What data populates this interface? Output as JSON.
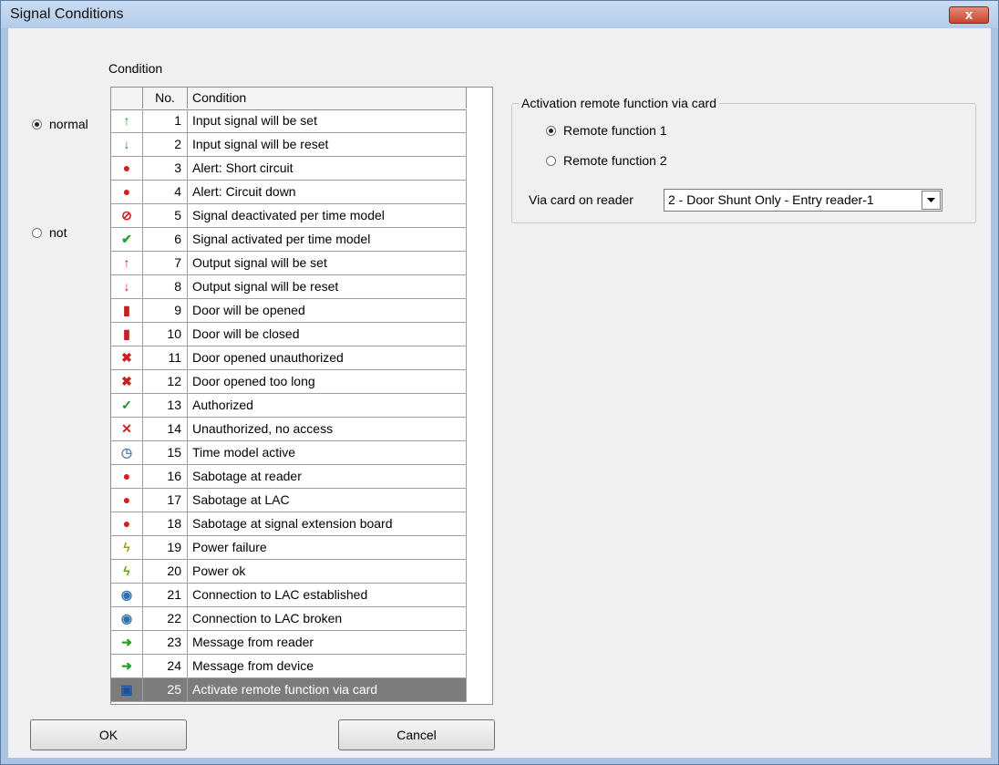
{
  "window": {
    "title": "Signal Conditions",
    "close_label": "x"
  },
  "condition_label": "Condition",
  "mode": {
    "normal": {
      "label": "normal",
      "checked": true
    },
    "not": {
      "label": "not",
      "checked": false
    }
  },
  "grid": {
    "headers": {
      "no": "No.",
      "condition": "Condition"
    },
    "rows": [
      {
        "icon": "arrow-up-green-icon",
        "glyph": "↑",
        "color": "#1aa31a",
        "no": "1",
        "label": "Input signal will be set"
      },
      {
        "icon": "arrow-down-green-icon",
        "glyph": "↓",
        "color": "#1aa31a",
        "no": "2",
        "label": "Input signal will be reset"
      },
      {
        "icon": "alarm-short-circuit-icon",
        "glyph": "●",
        "color": "#d32020",
        "no": "3",
        "label": "Alert: Short circuit"
      },
      {
        "icon": "alarm-circuit-down-icon",
        "glyph": "●",
        "color": "#d32020",
        "no": "4",
        "label": "Alert: Circuit down"
      },
      {
        "icon": "no-entry-icon",
        "glyph": "⊘",
        "color": "#d32020",
        "no": "5",
        "label": "Signal deactivated per time model"
      },
      {
        "icon": "check-circle-icon",
        "glyph": "✔",
        "color": "#2a9e2a",
        "no": "6",
        "label": "Signal activated per time model"
      },
      {
        "icon": "arrow-up-red-icon",
        "glyph": "↑",
        "color": "#d32020",
        "no": "7",
        "label": "Output signal will be set"
      },
      {
        "icon": "arrow-down-red-icon",
        "glyph": "↓",
        "color": "#d32020",
        "no": "8",
        "label": "Output signal will be reset"
      },
      {
        "icon": "door-open-icon",
        "glyph": "▮",
        "color": "#c62020",
        "no": "9",
        "label": "Door will be opened"
      },
      {
        "icon": "door-closed-icon",
        "glyph": "▮",
        "color": "#c62020",
        "no": "10",
        "label": "Door will be closed"
      },
      {
        "icon": "door-unauthorized-icon",
        "glyph": "✖",
        "color": "#c62020",
        "no": "11",
        "label": "Door opened unauthorized"
      },
      {
        "icon": "door-too-long-icon",
        "glyph": "✖",
        "color": "#c62020",
        "no": "12",
        "label": "Door opened too long"
      },
      {
        "icon": "checkmark-icon",
        "glyph": "✓",
        "color": "#1a8a1a",
        "no": "13",
        "label": "Authorized"
      },
      {
        "icon": "cross-icon",
        "glyph": "✕",
        "color": "#d32020",
        "no": "14",
        "label": "Unauthorized, no access"
      },
      {
        "icon": "clock-icon",
        "glyph": "◷",
        "color": "#5a7ea8",
        "no": "15",
        "label": "Time model active"
      },
      {
        "icon": "sabotage-reader-icon",
        "glyph": "●",
        "color": "#d32020",
        "no": "16",
        "label": "Sabotage at reader"
      },
      {
        "icon": "sabotage-lac-icon",
        "glyph": "●",
        "color": "#d32020",
        "no": "17",
        "label": "Sabotage at LAC"
      },
      {
        "icon": "sabotage-extension-icon",
        "glyph": "●",
        "color": "#d32020",
        "no": "18",
        "label": "Sabotage at signal extension board"
      },
      {
        "icon": "power-failure-icon",
        "glyph": "ϟ",
        "color": "#9a9a1a",
        "no": "19",
        "label": "Power failure"
      },
      {
        "icon": "power-ok-icon",
        "glyph": "ϟ",
        "color": "#6a9a1a",
        "no": "20",
        "label": "Power ok"
      },
      {
        "icon": "globe-connected-icon",
        "glyph": "◉",
        "color": "#2e6fb0",
        "no": "21",
        "label": "Connection to LAC established"
      },
      {
        "icon": "globe-broken-icon",
        "glyph": "◉",
        "color": "#2e6fb0",
        "no": "22",
        "label": "Connection to LAC broken"
      },
      {
        "icon": "message-reader-icon",
        "glyph": "➜",
        "color": "#2a9e2a",
        "no": "23",
        "label": "Message from reader"
      },
      {
        "icon": "message-device-icon",
        "glyph": "➜",
        "color": "#2a9e2a",
        "no": "24",
        "label": "Message from device"
      },
      {
        "icon": "card-remote-icon",
        "glyph": "▣",
        "color": "#1d4fa0",
        "no": "25",
        "label": "Activate remote function via card",
        "selected": true
      }
    ]
  },
  "remote": {
    "legend": "Activation remote function via card",
    "options": [
      {
        "label": "Remote function  1",
        "checked": true
      },
      {
        "label": "Remote function  2",
        "checked": false
      }
    ],
    "reader_label": "Via card on reader",
    "reader_value": "2 - Door Shunt Only - Entry reader-1"
  },
  "buttons": {
    "ok": "OK",
    "cancel": "Cancel"
  }
}
